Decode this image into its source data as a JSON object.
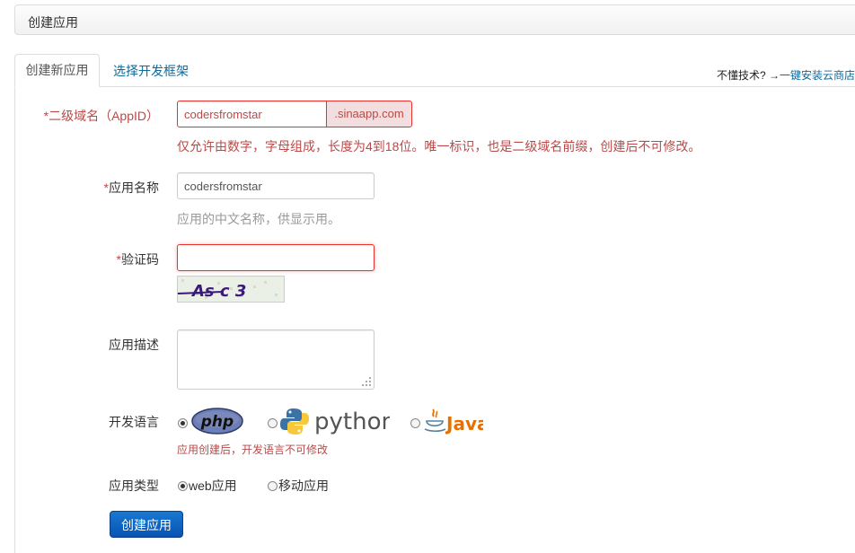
{
  "header": {
    "title": "创建应用"
  },
  "tabs": [
    {
      "label": "创建新应用",
      "active": true
    },
    {
      "label": "选择开发框架",
      "active": false
    }
  ],
  "help": {
    "prefix": "不懂技术?",
    "link": "一键安装云商店"
  },
  "form": {
    "domain": {
      "required_mark": "*",
      "label": "二级域名（AppID）",
      "value": "codersfromstar",
      "suffix": ".sinaapp.com",
      "hint": "仅允许由数字，字母组成，长度为4到18位。唯一标识，也是二级域名前缀，创建后不可修改。"
    },
    "app_name": {
      "required_mark": "*",
      "label": "应用名称",
      "value": "codersfromstar",
      "hint": "应用的中文名称，供显示用。"
    },
    "captcha": {
      "required_mark": "*",
      "label": "验证码",
      "value": "",
      "image_text": "As c 3"
    },
    "description": {
      "label": "应用描述",
      "value": ""
    },
    "language": {
      "label": "开发语言",
      "options": [
        {
          "name": "php",
          "selected": true
        },
        {
          "name": "python",
          "selected": false
        },
        {
          "name": "Java",
          "selected": false
        }
      ],
      "note": "应用创建后，开发语言不可修改"
    },
    "app_type": {
      "label": "应用类型",
      "options": [
        {
          "label": "web应用",
          "selected": true
        },
        {
          "label": "移动应用",
          "selected": false
        }
      ]
    },
    "submit_label": "创建应用"
  },
  "colors": {
    "error": "#b94a48",
    "link": "#0a6a9a",
    "primary": "#0753b4"
  }
}
